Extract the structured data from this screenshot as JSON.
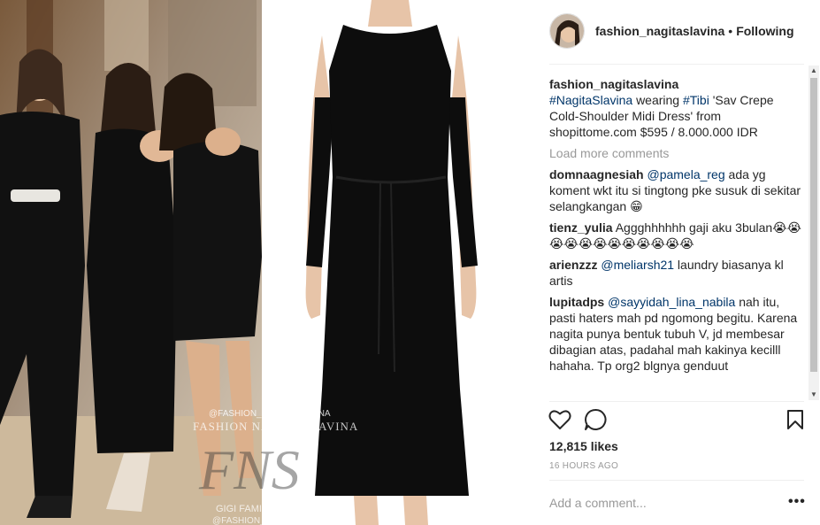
{
  "post": {
    "username": "fashion_nagitaslavina",
    "follow_dot": "•",
    "follow_status": "Following",
    "photo_watermark": {
      "top": "@FASHION_NAGITASLAVINA",
      "name": "FASHION NAGITA SLAVINA",
      "logo": "FNS",
      "sub": "GIGI FAMILY",
      "bottom": "@FASHION_NAGITASLAVINA"
    }
  },
  "caption": {
    "username": "fashion_nagitaslavina",
    "tag1": "#NagitaSlavina",
    "text1": " wearing ",
    "tag2": "#Tibi",
    "text2": " 'Sav Crepe Cold-Shoulder Midi Dress' from shopittome.com $595 / 8.000.000 IDR"
  },
  "load_more": "Load more comments",
  "comments": [
    {
      "user": "domnaagnesiah",
      "mention": "@pamela_reg",
      "text": " ada yg koment wkt itu si tingtong pke susuk di sekitar selangkangan 😁"
    },
    {
      "user": "tienz_yulia",
      "mention": "",
      "text": "Aggghhhhhh gaji aku 3bulan😭😭😭😭😭😭😭😭😭😭😭😭"
    },
    {
      "user": "arienzzz",
      "mention": "@meliarsh21",
      "text": " laundry biasanya kl artis"
    },
    {
      "user": "lupitadps",
      "mention": "@sayyidah_lina_nabila",
      "text": " nah itu, pasti haters mah pd ngomong begitu. Karena nagita punya bentuk tubuh V, jd membesar dibagian atas, padahal mah kakinya kecilll hahaha. Tp org2 blgnya genduut"
    }
  ],
  "likes": "12,815 likes",
  "timestamp": "16 HOURS AGO",
  "add_comment_placeholder": "Add a comment...",
  "more_options": "•••",
  "icons": [
    "heart-icon",
    "comment-icon",
    "bookmark-icon",
    "more-options-icon"
  ],
  "colors": {
    "link": "#003569",
    "text": "#262626",
    "muted": "#999999",
    "dress": "#0d0d0d"
  }
}
